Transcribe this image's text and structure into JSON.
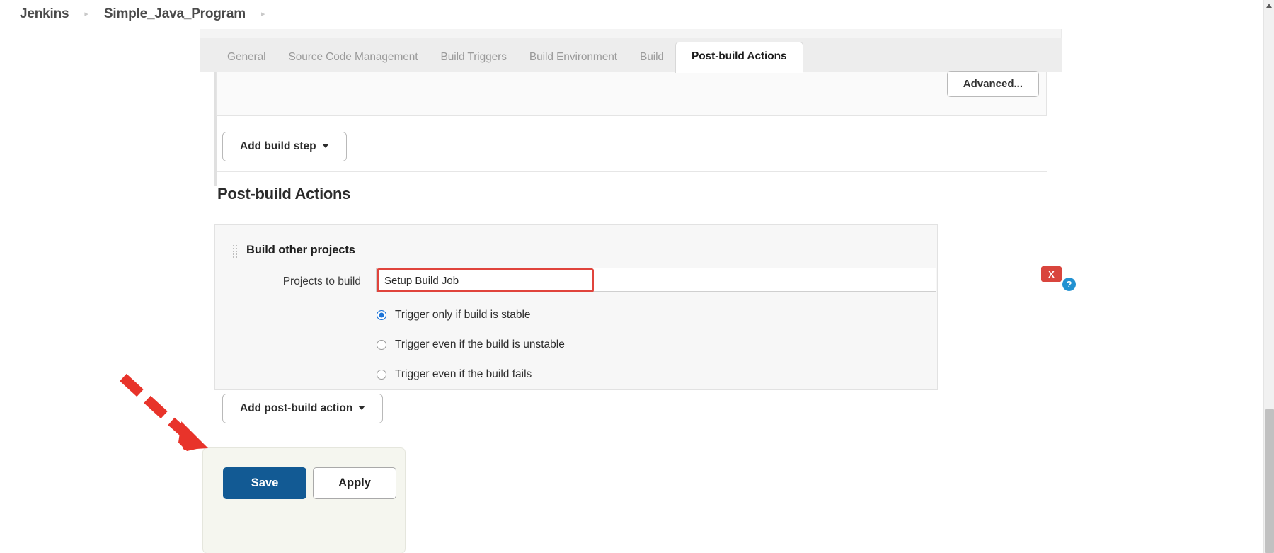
{
  "breadcrumb": {
    "items": [
      {
        "label": "Jenkins"
      },
      {
        "label": "Simple_Java_Program"
      }
    ],
    "separator": "▸"
  },
  "tabs": [
    {
      "label": "General",
      "active": false
    },
    {
      "label": "Source Code Management",
      "active": false
    },
    {
      "label": "Build Triggers",
      "active": false
    },
    {
      "label": "Build Environment",
      "active": false
    },
    {
      "label": "Build",
      "active": false
    },
    {
      "label": "Post-build Actions",
      "active": true
    }
  ],
  "build_section": {
    "advanced_label": "Advanced...",
    "add_build_step_label": "Add build step"
  },
  "post_build": {
    "heading": "Post-build Actions",
    "add_action_label": "Add post-build action",
    "card": {
      "title": "Build other projects",
      "delete_label": "X",
      "help_label": "?",
      "projects_label": "Projects to build",
      "projects_value": "Setup Build Job",
      "projects_placeholder": "",
      "triggers": [
        {
          "label": "Trigger only if build is stable",
          "selected": true
        },
        {
          "label": "Trigger even if the build is unstable",
          "selected": false
        },
        {
          "label": "Trigger even if the build fails",
          "selected": false
        }
      ]
    }
  },
  "footer": {
    "save_label": "Save",
    "apply_label": "Apply"
  },
  "colors": {
    "primary_button": "#125a94",
    "delete_red": "#d9453d",
    "help_blue": "#2291d1",
    "radio_selected": "#1b73d8",
    "highlight_outline": "#e0443c",
    "annotation_arrow": "#e8332a"
  }
}
